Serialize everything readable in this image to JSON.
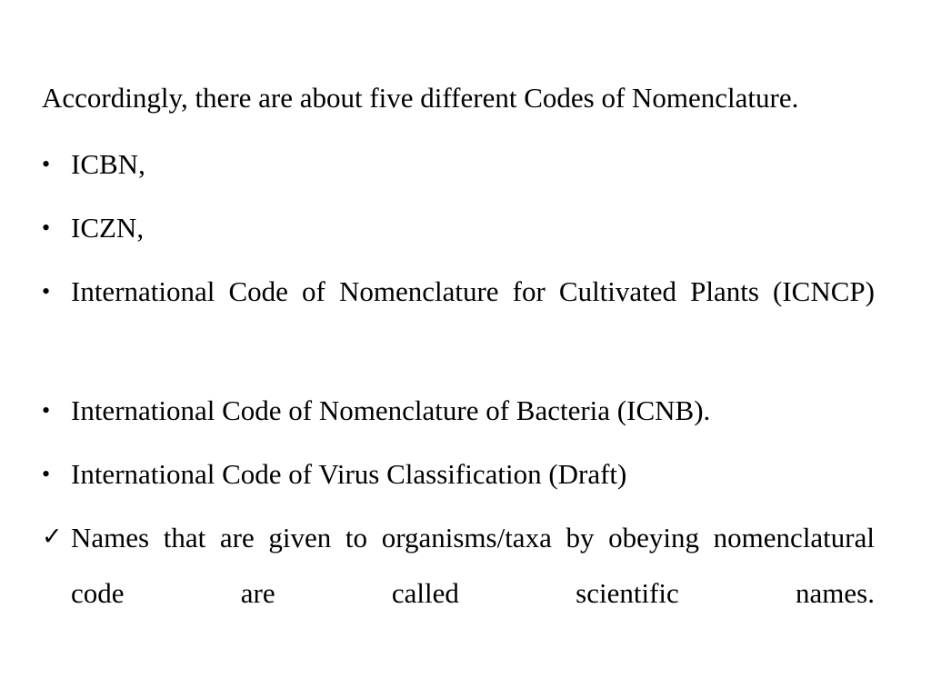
{
  "slide": {
    "background_color": "#ffffff",
    "text_color": "#000000",
    "intro": "Accordingly, there are about five different Codes of Nomenclature.",
    "bullets": [
      {
        "marker": "bullet-dot",
        "marker_glyph": "•",
        "text": "ICBN,",
        "justified": false
      },
      {
        "marker": "bullet-dot",
        "marker_glyph": "•",
        "text": "ICZN,",
        "justified": false
      },
      {
        "marker": "bullet-dot",
        "marker_glyph": "•",
        "text": "International Code of Nomenclature for Cultivated Plants (ICNCP)",
        "justified": true
      },
      {
        "marker": "bullet-dot",
        "marker_glyph": "•",
        "text": "International Code of Nomenclature of Bacteria (ICNB).",
        "justified": false
      },
      {
        "marker": "bullet-dot",
        "marker_glyph": "•",
        "text": "International Code of Virus Classification (Draft)",
        "justified": false
      },
      {
        "marker": "check-mark",
        "marker_glyph": "✓",
        "text": "Names that are given to organisms/taxa by obeying nomenclatural code are called scientific names.",
        "justified": true
      }
    ]
  }
}
